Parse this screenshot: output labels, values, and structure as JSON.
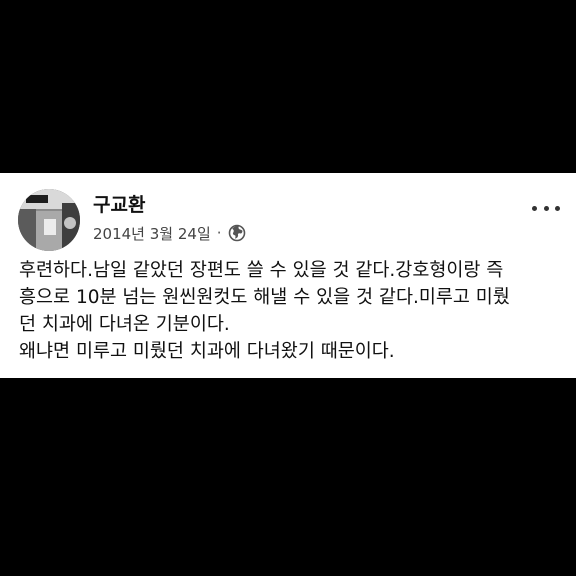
{
  "post": {
    "author": "구교환",
    "date": "2014년 3월 24일",
    "separator": "·",
    "privacy_icon": "globe-icon",
    "more_icon": "more-dots-icon",
    "body_lines": [
      "후련하다.남일 같았던 장편도 쓸 수 있을 것 같다.강호형이랑 즉",
      "흥으로 10분 넘는 원씬원컷도 해낼 수 있을 것 같다.미루고 미뤘",
      "던 치과에 다녀온 기분이다.",
      "왜냐면 미루고 미뤘던 치과에 다녀왔기 때문이다."
    ]
  },
  "colors": {
    "background": "#000000",
    "card": "#ffffff",
    "text_primary": "#111111",
    "text_secondary": "#444444"
  }
}
